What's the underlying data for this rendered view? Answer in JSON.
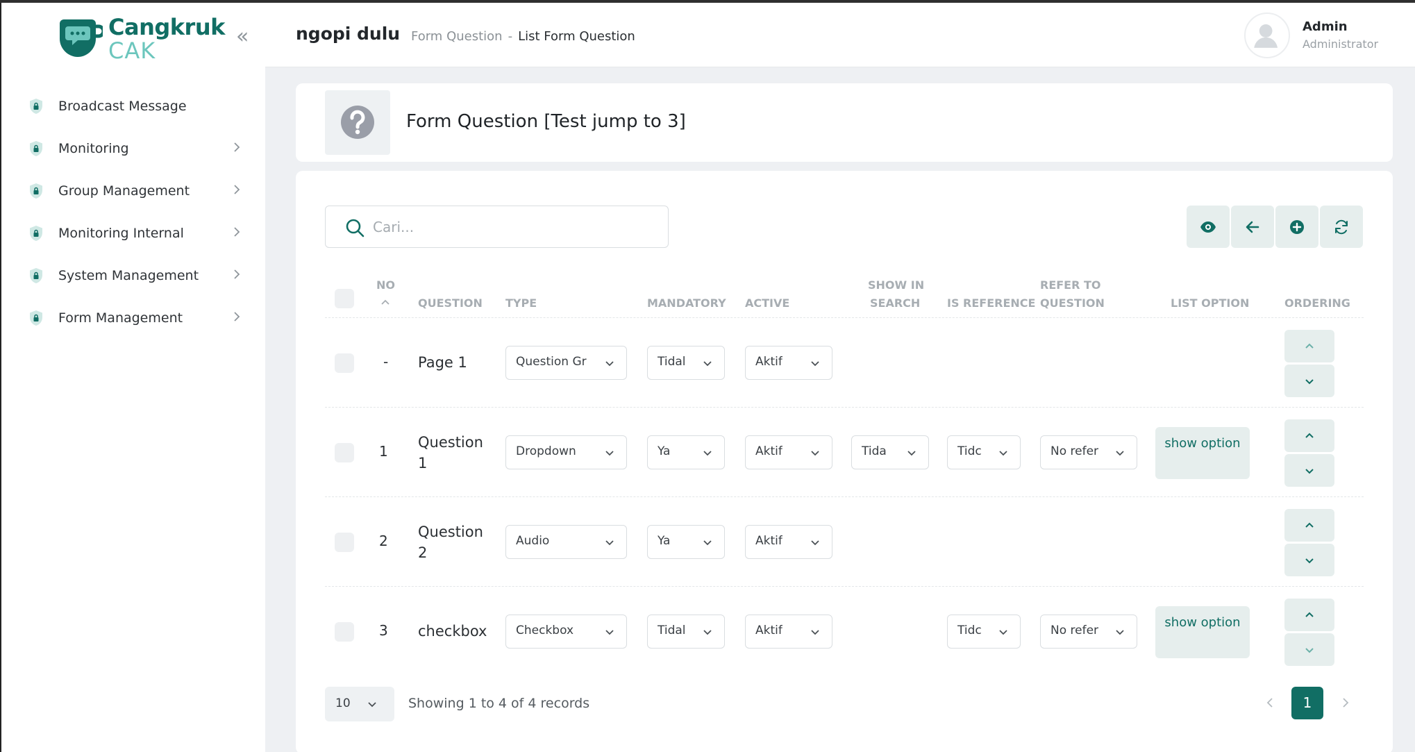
{
  "brand": {
    "name_line1": "Cangkruk",
    "name_line2": "CAK",
    "colors": {
      "primary": "#116e64",
      "accent": "#6cc6bd"
    }
  },
  "sidebar": {
    "items": [
      {
        "label": "Broadcast Message",
        "icon": "shield-lock-icon",
        "has_children": false
      },
      {
        "label": "Monitoring",
        "icon": "shield-lock-icon",
        "has_children": true
      },
      {
        "label": "Group Management",
        "icon": "shield-lock-icon",
        "has_children": true
      },
      {
        "label": "Monitoring Internal",
        "icon": "shield-lock-icon",
        "has_children": true
      },
      {
        "label": "System Management",
        "icon": "shield-lock-icon",
        "has_children": true
      },
      {
        "label": "Form Management",
        "icon": "shield-lock-icon",
        "has_children": true
      }
    ]
  },
  "header": {
    "title": "ngopi dulu",
    "breadcrumb": {
      "parent": "Form Question",
      "separator": "-",
      "current": "List Form Question"
    },
    "user": {
      "name": "Admin",
      "role": "Administrator"
    }
  },
  "page": {
    "title": "Form Question [Test jump to 3]"
  },
  "toolbar": {
    "search_placeholder": "Cari...",
    "buttons": [
      "eye-icon",
      "arrow-left-icon",
      "plus-circle-icon",
      "refresh-icon"
    ]
  },
  "table": {
    "headers": {
      "no": "NO",
      "question": "QUESTION",
      "type": "TYPE",
      "mandatory": "MANDATORY",
      "active": "ACTIVE",
      "show_in_search_1": "SHOW IN",
      "show_in_search_2": "SEARCH",
      "is_reference": "IS REFERENCE",
      "refer_to_1": "REFER TO",
      "refer_to_2": "QUESTION",
      "list_option": "LIST OPTION",
      "ordering": "ORDERING"
    },
    "rows": [
      {
        "no": "-",
        "question_1": "Page 1",
        "question_2": "",
        "type": "Question Gr",
        "mandatory": "Tidal",
        "active": "Aktif",
        "show_in_search": "",
        "is_reference": "",
        "refer_to": "",
        "show_option": ""
      },
      {
        "no": "1",
        "question_1": "Question",
        "question_2": "1",
        "type": "Dropdown",
        "mandatory": "Ya",
        "active": "Aktif",
        "show_in_search": "Tida",
        "is_reference": "Tidc",
        "refer_to": "No refer",
        "show_option": "show option"
      },
      {
        "no": "2",
        "question_1": "Question",
        "question_2": "2",
        "type": "Audio",
        "mandatory": "Ya",
        "active": "Aktif",
        "show_in_search": "",
        "is_reference": "",
        "refer_to": "",
        "show_option": ""
      },
      {
        "no": "3",
        "question_1": "checkbox",
        "question_2": "",
        "type": "Checkbox",
        "mandatory": "Tidal",
        "active": "Aktif",
        "show_in_search": "",
        "is_reference": "Tidc",
        "refer_to": "No refer",
        "show_option": "show option"
      }
    ]
  },
  "footer": {
    "per_page": "10",
    "records_text": "Showing 1 to 4 of 4 records",
    "current_page": "1"
  }
}
